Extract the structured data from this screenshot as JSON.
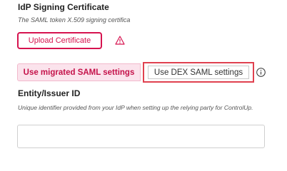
{
  "certificate": {
    "title": "IdP Signing Certificate",
    "description": "The SAML token X.509 signing certifica",
    "upload_label": "Upload Certificate",
    "warning_icon": "warning-triangle-icon"
  },
  "saml_toggle": {
    "options": [
      {
        "label": "Use migrated SAML settings",
        "selected": true
      },
      {
        "label": "Use DEX SAML settings",
        "selected": false
      }
    ],
    "info_icon": "info-circle-icon"
  },
  "entity_field": {
    "label": "Entity/Issuer ID",
    "description": "Unique identifier provided from your IdP when setting up the relying party for ControlUp.",
    "value": "",
    "placeholder": ""
  },
  "colors": {
    "accent": "#d6134f",
    "selected_bg": "#fbe3ec",
    "highlight_border": "#e0414f"
  }
}
